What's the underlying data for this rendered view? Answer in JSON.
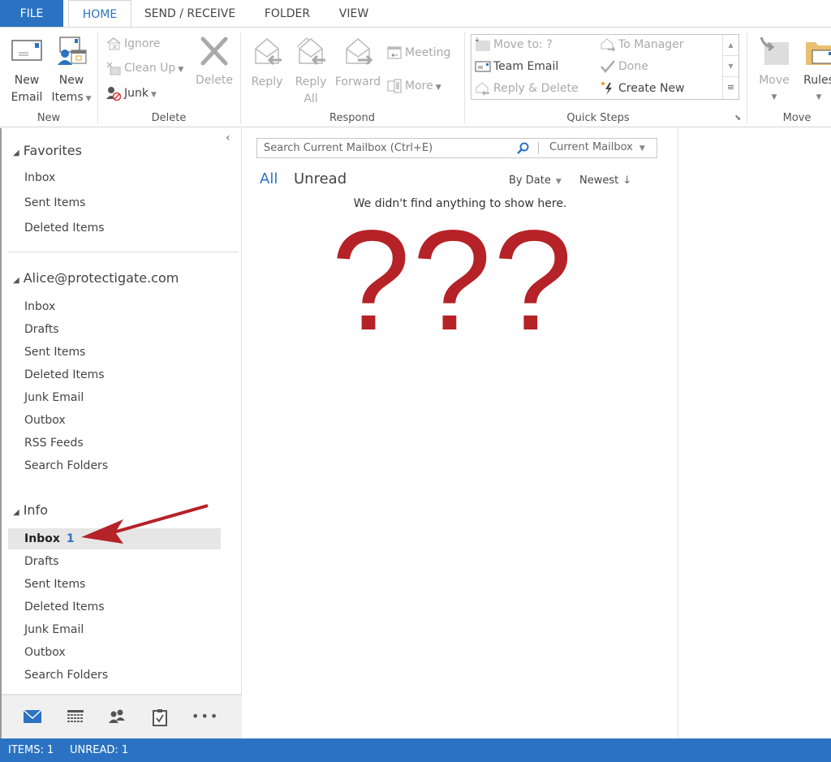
{
  "tabs": [
    {
      "label": "FILE"
    },
    {
      "label": "HOME"
    },
    {
      "label": "SEND / RECEIVE"
    },
    {
      "label": "FOLDER"
    },
    {
      "label": "VIEW"
    }
  ],
  "ribbon": {
    "new": {
      "group_label": "New",
      "new_email": [
        "New",
        "Email"
      ],
      "new_items": [
        "New",
        "Items"
      ]
    },
    "delete": {
      "group_label": "Delete",
      "ignore": "Ignore",
      "clean_up": "Clean Up",
      "junk": "Junk",
      "delete": "Delete"
    },
    "respond": {
      "group_label": "Respond",
      "reply": "Reply",
      "reply_all": [
        "Reply",
        "All"
      ],
      "forward": "Forward",
      "meeting": "Meeting",
      "more": "More"
    },
    "quick_steps": {
      "group_label": "Quick Steps",
      "items": [
        {
          "label": "Move to: ?",
          "icon": "folder-move-icon",
          "enabled": false
        },
        {
          "label": "Team Email",
          "icon": "team-email-icon",
          "enabled": true
        },
        {
          "label": "Reply & Delete",
          "icon": "reply-delete-icon",
          "enabled": false
        },
        {
          "label": "To Manager",
          "icon": "to-manager-icon",
          "enabled": false
        },
        {
          "label": "Done",
          "icon": "checkmark-icon",
          "enabled": false
        },
        {
          "label": "Create New",
          "icon": "lightning-icon",
          "enabled": true
        }
      ]
    },
    "move": {
      "group_label": "Move",
      "move": "Move",
      "rules": "Rules"
    }
  },
  "sidebar": {
    "favorites": {
      "title": "Favorites",
      "items": [
        "Inbox",
        "Sent Items",
        "Deleted Items"
      ]
    },
    "account": {
      "title": "Alice@protectigate.com",
      "items": [
        "Inbox",
        "Drafts",
        "Sent Items",
        "Deleted Items",
        "Junk Email",
        "Outbox",
        "RSS Feeds",
        "Search Folders"
      ]
    },
    "info": {
      "title": "Info",
      "selected": {
        "label": "Inbox",
        "count": "1"
      },
      "items": [
        "Drafts",
        "Sent Items",
        "Deleted Items",
        "Junk Email",
        "Outbox",
        "Search Folders"
      ]
    },
    "nav_icons": [
      "mail-icon",
      "calendar-icon",
      "people-icon",
      "tasks-icon",
      "more-icon"
    ]
  },
  "main": {
    "search_placeholder": "Search Current Mailbox (Ctrl+E)",
    "search_scope": "Current Mailbox",
    "filter_all": "All",
    "filter_unread": "Unread",
    "sort_by": "By Date",
    "sort_order": "Newest",
    "empty_message": "We didn't find anything to show here.",
    "annotation_text": "???"
  },
  "statusbar": {
    "items": "ITEMS: 1",
    "unread": "UNREAD: 1"
  },
  "colors": {
    "accent": "#2b73c2",
    "annotation_red": "#b52227"
  }
}
